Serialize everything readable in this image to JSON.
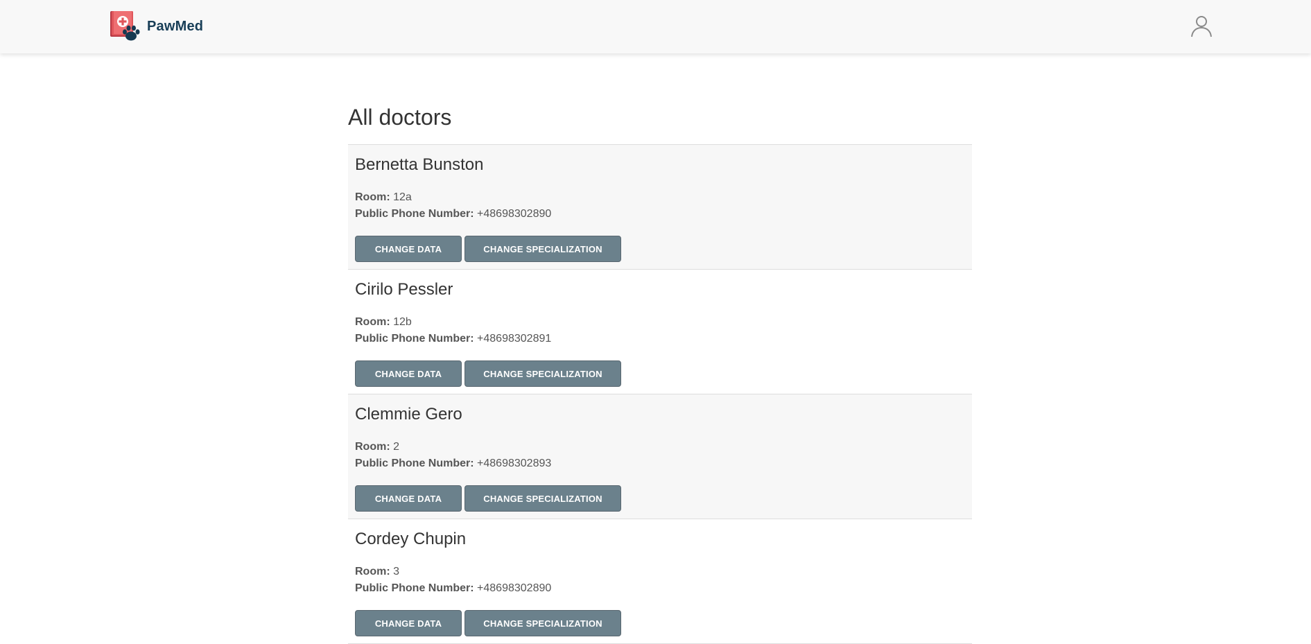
{
  "brand": {
    "name": "PawMed"
  },
  "page": {
    "title": "All doctors"
  },
  "labels": {
    "room": "Room:",
    "phone": "Public Phone Number:",
    "change_data": "CHANGE DATA",
    "change_specialization": "CHANGE SPECIALIZATION"
  },
  "doctors": [
    {
      "name": "Bernetta Bunston",
      "room": "12a",
      "phone": "+48698302890"
    },
    {
      "name": "Cirilo Pessler",
      "room": "12b",
      "phone": "+48698302891"
    },
    {
      "name": "Clemmie Gero",
      "room": "2",
      "phone": "+48698302893"
    },
    {
      "name": "Cordey Chupin",
      "room": "3",
      "phone": "+48698302890"
    }
  ],
  "colors": {
    "brand_text": "#183e57",
    "logo_red": "#e0565b",
    "paw": "#163a52",
    "button": "#6b818c",
    "navbar": "#f8f8f8",
    "row_shaded": "#f7f7f7"
  },
  "icons": {
    "logo": "medical-book-paw-icon",
    "user": "user-account-icon"
  }
}
